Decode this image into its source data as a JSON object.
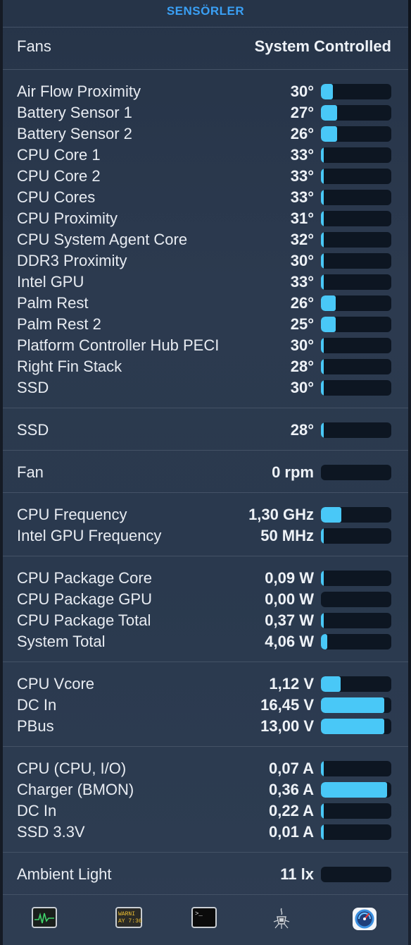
{
  "header": {
    "title": "SENSÖRLER"
  },
  "fans_row": {
    "label": "Fans",
    "value": "System Controlled"
  },
  "temperatures": [
    {
      "label": "Air Flow Proximity",
      "value": "30°",
      "level": 0.17
    },
    {
      "label": "Battery Sensor 1",
      "value": "27°",
      "level": 0.23
    },
    {
      "label": "Battery Sensor 2",
      "value": "26°",
      "level": 0.23
    },
    {
      "label": "CPU Core 1",
      "value": "33°",
      "level": 0.03
    },
    {
      "label": "CPU Core 2",
      "value": "33°",
      "level": 0.03
    },
    {
      "label": "CPU Cores",
      "value": "33°",
      "level": 0.03
    },
    {
      "label": "CPU Proximity",
      "value": "31°",
      "level": 0.03
    },
    {
      "label": "CPU System Agent Core",
      "value": "32°",
      "level": 0.03
    },
    {
      "label": "DDR3 Proximity",
      "value": "30°",
      "level": 0.03
    },
    {
      "label": "Intel GPU",
      "value": "33°",
      "level": 0.03
    },
    {
      "label": "Palm Rest",
      "value": "26°",
      "level": 0.21
    },
    {
      "label": "Palm Rest 2",
      "value": "25°",
      "level": 0.21
    },
    {
      "label": "Platform Controller Hub PECI",
      "value": "30°",
      "level": 0.03
    },
    {
      "label": "Right Fin Stack",
      "value": "28°",
      "level": 0.03
    },
    {
      "label": "SSD",
      "value": "30°",
      "level": 0.03
    }
  ],
  "ssd": [
    {
      "label": "SSD",
      "value": "28°",
      "level": 0.03
    }
  ],
  "fan": [
    {
      "label": "Fan",
      "value": "0 rpm",
      "level": 0
    }
  ],
  "frequencies": [
    {
      "label": "CPU Frequency",
      "value": "1,30 GHz",
      "level": 0.29
    },
    {
      "label": "Intel GPU Frequency",
      "value": "50 MHz",
      "level": 0.03
    }
  ],
  "power": [
    {
      "label": "CPU Package Core",
      "value": "0,09 W",
      "level": 0.02
    },
    {
      "label": "CPU Package GPU",
      "value": "0,00 W",
      "level": 0
    },
    {
      "label": "CPU Package Total",
      "value": "0,37 W",
      "level": 0.02
    },
    {
      "label": "System Total",
      "value": "4,06 W",
      "level": 0.09
    }
  ],
  "voltage": [
    {
      "label": "CPU Vcore",
      "value": "1,12 V",
      "level": 0.28
    },
    {
      "label": "DC In",
      "value": "16,45 V",
      "level": 0.9
    },
    {
      "label": "PBus",
      "value": "13,00 V",
      "level": 0.9
    }
  ],
  "current": [
    {
      "label": "CPU (CPU, I/O)",
      "value": "0,07 A",
      "level": 0.02
    },
    {
      "label": "Charger (BMON)",
      "value": "0,36 A",
      "level": 0.94
    },
    {
      "label": "DC In",
      "value": "0,22 A",
      "level": 0.02
    },
    {
      "label": "SSD 3.3V",
      "value": "0,01 A",
      "level": 0.02
    }
  ],
  "light": [
    {
      "label": "Ambient Light",
      "value": "11 lx",
      "level": 0
    }
  ],
  "dock": {
    "console_text_1": "WARNI",
    "console_text_2": "AY 7:36",
    "terminal_prompt": ">_"
  },
  "colors": {
    "accent": "#3aa0f5",
    "bar_fill": "#49c8f7",
    "bar_track": "#0d1622"
  }
}
